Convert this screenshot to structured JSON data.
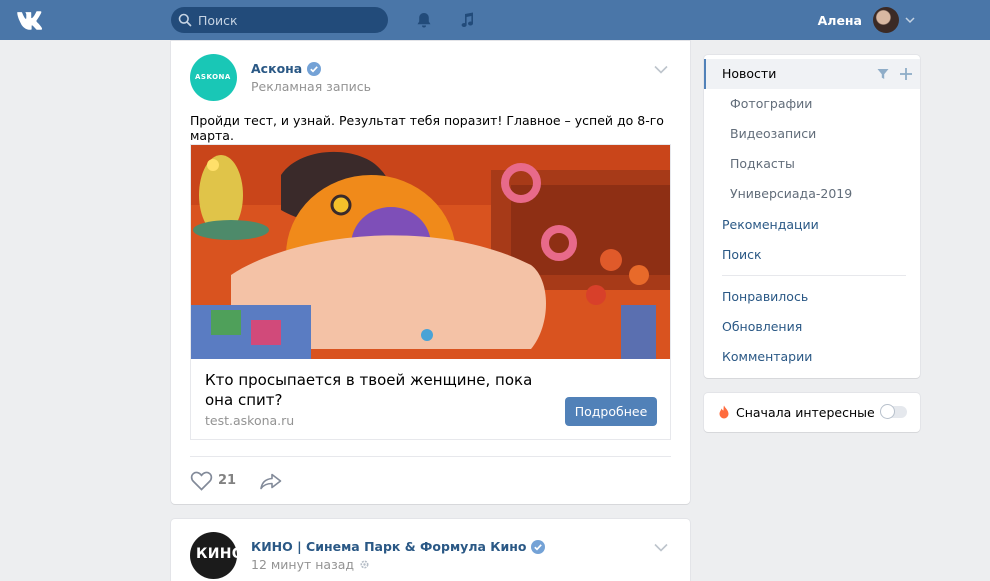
{
  "header": {
    "search_placeholder": "Поиск",
    "user_name": "Алена",
    "icons": [
      "vk-logo-icon",
      "search-icon",
      "bell-icon",
      "music-icon",
      "chevron-down-icon"
    ],
    "bg_color": "#4a76a8"
  },
  "posts": [
    {
      "avatar_text": "ASKONA",
      "author": "Аскона",
      "subline": "Рекламная запись",
      "text": "Пройди тест, и узнай. Результат тебя поразит! Главное – успей до 8-го марта.",
      "snippet": {
        "title": "Кто просыпается в твоей женщине, пока она спит?",
        "domain": "test.askona.ru",
        "button": "Подробнее"
      },
      "likes": "21"
    },
    {
      "avatar_text": "КИНӦ",
      "author": "КИНО | Синема Парк & Формула Кино",
      "subline": "12 минут назад"
    }
  ],
  "menu": {
    "items": [
      {
        "label": "Новости",
        "active": true
      },
      {
        "label": "Фотографии"
      },
      {
        "label": "Видеозаписи"
      },
      {
        "label": "Подкасты"
      },
      {
        "label": "Универсиада-2019"
      },
      {
        "label": "Рекомендации"
      },
      {
        "label": "Поиск"
      },
      {
        "label": "Понравилось"
      },
      {
        "label": "Обновления"
      },
      {
        "label": "Комментарии"
      }
    ]
  },
  "toggle": {
    "label": "Сначала интересные",
    "on": false
  },
  "colors": {
    "accent": "#5181b8",
    "link": "#2a5885",
    "background": "#edeef0"
  }
}
